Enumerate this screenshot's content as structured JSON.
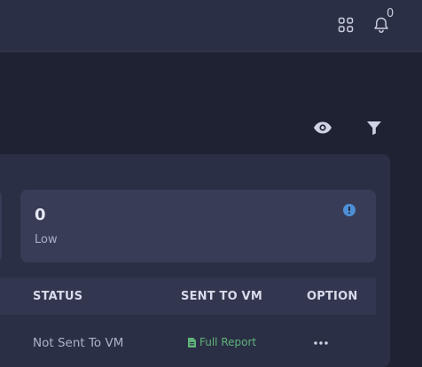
{
  "header": {
    "apps_icon": "apps-grid-icon",
    "notifications_icon": "bell-icon",
    "notification_count": "0"
  },
  "toolbar": {
    "view_icon": "eye-icon",
    "filter_icon": "filter-icon"
  },
  "summary": {
    "cards": [
      {
        "value": "0",
        "label": "Low",
        "info_icon": "info-icon"
      }
    ]
  },
  "table": {
    "columns": [
      "STATUS",
      "SENT TO VM",
      "OPTION"
    ],
    "rows": [
      {
        "status": "Not Sent To VM",
        "sent_to_vm": "Full Report",
        "option_icon": "more-horizontal-icon"
      }
    ]
  },
  "colors": {
    "page_bg": "#1f2233",
    "panel_bg": "#2b2f45",
    "card_bg": "#383c56",
    "info_accent": "#4d8fd6",
    "report_link": "#5fb27a"
  }
}
